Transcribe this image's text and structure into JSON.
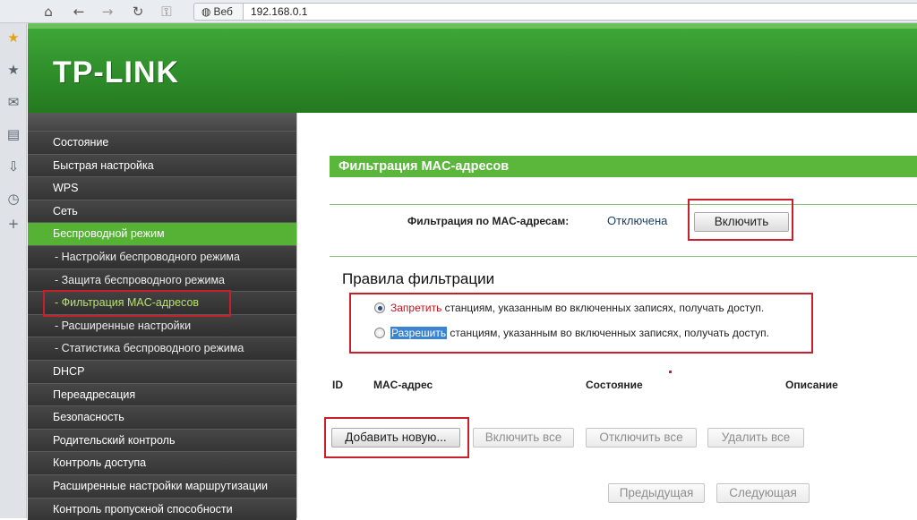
{
  "browser": {
    "site_button": "Веб",
    "address": "192.168.0.1",
    "icons": [
      "home-icon",
      "back-icon",
      "forward-icon",
      "reload-icon",
      "key-icon",
      "globe-icon"
    ],
    "side_icons": [
      "star-filled-icon",
      "star-icon",
      "mail-icon",
      "note-icon",
      "download-icon",
      "clock-icon",
      "plus-icon"
    ]
  },
  "header": {
    "logo": "TP-LINK"
  },
  "menu": {
    "items": [
      {
        "label": "Состояние",
        "type": "main"
      },
      {
        "label": "Быстрая настройка",
        "type": "main"
      },
      {
        "label": "WPS",
        "type": "main"
      },
      {
        "label": "Сеть",
        "type": "main"
      },
      {
        "label": "Беспроводной режим",
        "type": "main",
        "active": true
      },
      {
        "label": "- Настройки беспроводного режима",
        "type": "sub"
      },
      {
        "label": "- Защита беспроводного режима",
        "type": "sub"
      },
      {
        "label": "- Фильтрация MAC-адресов",
        "type": "sub",
        "selected": true
      },
      {
        "label": "- Расширенные настройки",
        "type": "sub"
      },
      {
        "label": "- Статистика беспроводного режима",
        "type": "sub"
      },
      {
        "label": "DHCP",
        "type": "main"
      },
      {
        "label": "Переадресация",
        "type": "main"
      },
      {
        "label": "Безопасность",
        "type": "main"
      },
      {
        "label": "Родительский контроль",
        "type": "main"
      },
      {
        "label": "Контроль доступа",
        "type": "main"
      },
      {
        "label": "Расширенные настройки маршрутизации",
        "type": "main"
      },
      {
        "label": "Контроль пропускной способности",
        "type": "main"
      }
    ]
  },
  "content": {
    "section_title": "Фильтрация MAC-адресов",
    "filter_label": "Фильтрация по MAC-адресам:",
    "filter_status": "Отключена",
    "enable_button": "Включить",
    "rules_title": "Правила фильтрации",
    "rules": [
      {
        "keyword": "Запретить",
        "text": " станциям, указанным во включенных записях, получать доступ.",
        "checked": true
      },
      {
        "keyword": "Разрешить",
        "text": " станциям, указанным во включенных записях, получать доступ.",
        "checked": false
      }
    ],
    "columns": [
      "ID",
      "MAC-адрес",
      "Состояние",
      "Описание"
    ],
    "buttons": {
      "add_new": "Добавить новую...",
      "enable_all": "Включить все",
      "disable_all": "Отключить все",
      "delete_all": "Удалить все",
      "previous": "Предыдущая",
      "next": "Следующая"
    }
  }
}
